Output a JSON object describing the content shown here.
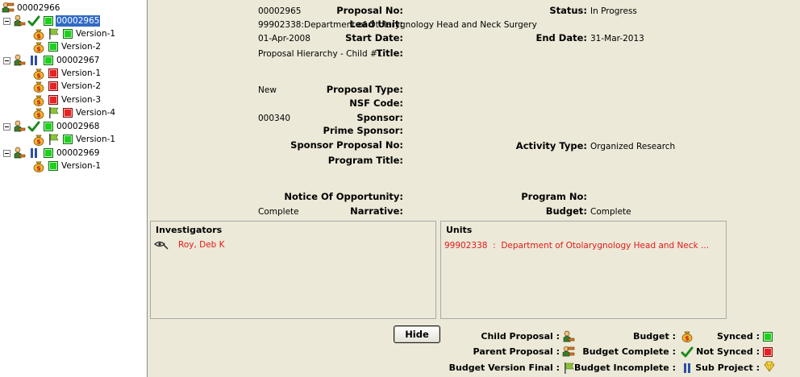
{
  "tree": {
    "root": "00002966",
    "nodes": [
      {
        "label": "00002965",
        "selected": true
      },
      {
        "label": "Version-1"
      },
      {
        "label": "Version-2"
      },
      {
        "label": "00002967"
      },
      {
        "label": "Version-1"
      },
      {
        "label": "Version-2"
      },
      {
        "label": "Version-3"
      },
      {
        "label": "Version-4"
      },
      {
        "label": "00002968"
      },
      {
        "label": "Version-1"
      },
      {
        "label": "00002969"
      },
      {
        "label": "Version-1"
      }
    ]
  },
  "details": {
    "proposal_no_label": "Proposal No:",
    "proposal_no": "00002965",
    "status_label": "Status:",
    "status": "In Progress",
    "lead_unit_label": "Lead Unit:",
    "lead_unit": "99902338:Department of Otolarygnology Head and Neck Surgery",
    "start_date_label": "Start Date:",
    "start_date": "01-Apr-2008",
    "end_date_label": "End Date:",
    "end_date": "31-Mar-2013",
    "title_label": "Title:",
    "title": "Proposal Hierarchy - Child #1",
    "proposal_type_label": "Proposal Type:",
    "proposal_type": "New",
    "nsf_code_label": "NSF Code:",
    "nsf_code": "",
    "sponsor_label": "Sponsor:",
    "sponsor": "000340",
    "prime_sponsor_label": "Prime Sponsor:",
    "prime_sponsor": "",
    "sponsor_proposal_no_label": "Sponsor Proposal No:",
    "sponsor_proposal_no": "",
    "activity_type_label": "Activity Type:",
    "activity_type": "Organized Research",
    "program_title_label": "Program Title:",
    "program_title": "",
    "notice_label": "Notice Of Opportunity:",
    "notice": "",
    "program_no_label": "Program No:",
    "program_no": "",
    "narrative_label": "Narrative:",
    "narrative": "Complete",
    "budget_label": "Budget:",
    "budget": "Complete"
  },
  "investigators": {
    "title": "Investigators",
    "items": [
      "Roy, Deb K"
    ]
  },
  "units": {
    "title": "Units",
    "items": [
      "99902338  :  Department of Otolarygnology Head and Neck ..."
    ]
  },
  "hide_button": "Hide",
  "legend": {
    "child_proposal": "Child Proposal :",
    "parent_proposal": "Parent Proposal :",
    "budget_version_final": "Budget Version Final :",
    "budget": "Budget :",
    "budget_complete": "Budget Complete :",
    "budget_incomplete": "Budget Incomplete :",
    "synced": "Synced :",
    "not_synced": "Not Synced :",
    "sub_project": "Sub Project :"
  },
  "colors": {
    "selection": "#316AC5",
    "synced": "#1ED01E",
    "not_synced": "#E82121",
    "red_text": "#E21A1A",
    "background": "#ECE9D8"
  }
}
